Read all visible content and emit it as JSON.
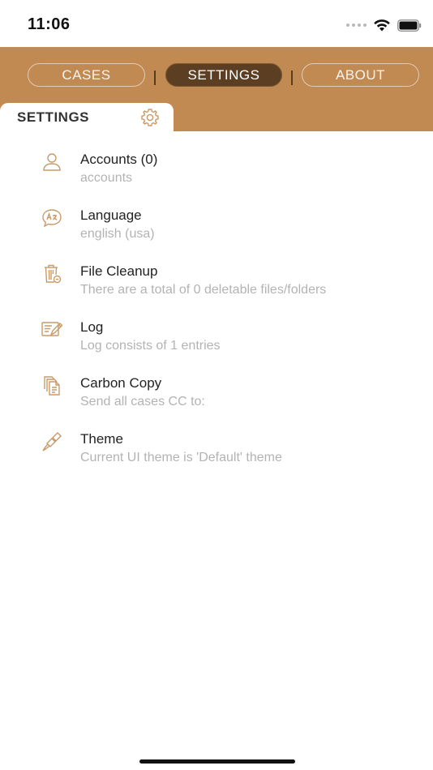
{
  "status_bar": {
    "time": "11:06"
  },
  "nav": {
    "segments": [
      {
        "label": "CASES",
        "selected": false
      },
      {
        "label": "SETTINGS",
        "selected": true
      },
      {
        "label": "ABOUT",
        "selected": false
      }
    ]
  },
  "section": {
    "title": "SETTINGS",
    "icon": "gear-icon"
  },
  "settings": [
    {
      "icon": "person-icon",
      "title": "Accounts (0)",
      "subtitle": "accounts"
    },
    {
      "icon": "language-bubble-icon",
      "title": "Language",
      "subtitle": "english (usa)"
    },
    {
      "icon": "trash-clean-icon",
      "title": "File Cleanup",
      "subtitle": "There are a total of 0 deletable files/folders"
    },
    {
      "icon": "log-pencil-icon",
      "title": "Log",
      "subtitle": "Log consists of 1 entries"
    },
    {
      "icon": "copy-documents-icon",
      "title": "Carbon Copy",
      "subtitle": "Send all cases CC to:"
    },
    {
      "icon": "paintbrush-icon",
      "title": "Theme",
      "subtitle": "Current UI theme is 'Default' theme"
    }
  ],
  "colors": {
    "accent": "#c08a52",
    "selected_segment": "#5c3e22",
    "icon_stroke": "#c99a68",
    "subtitle_text": "#b3b3b3"
  }
}
